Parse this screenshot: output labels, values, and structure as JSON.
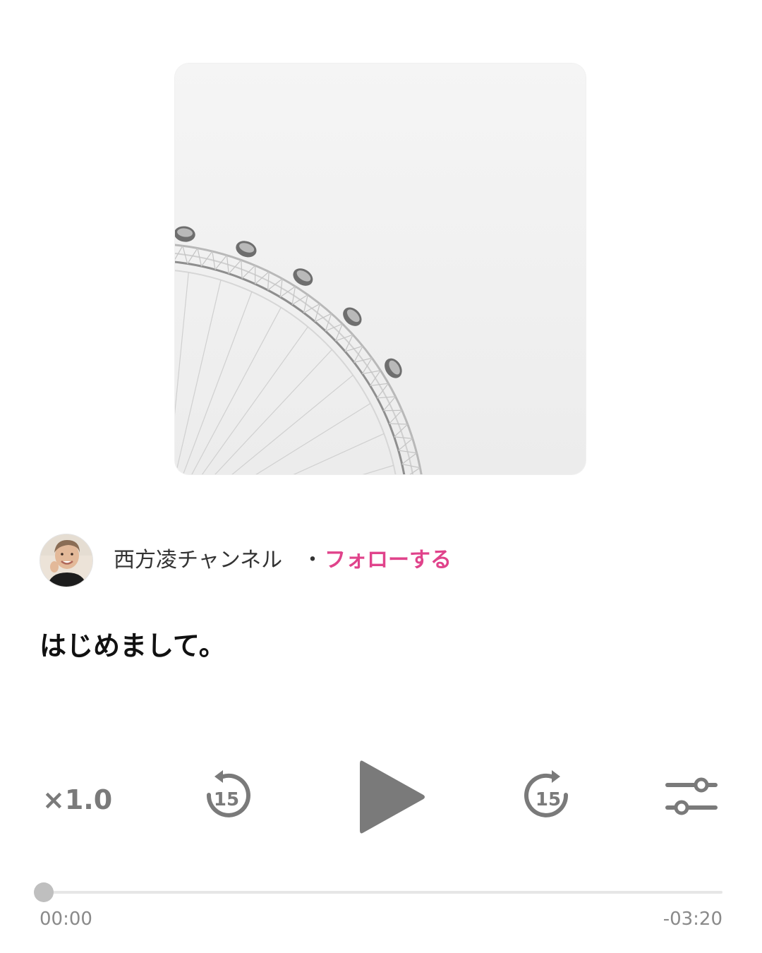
{
  "artwork": {
    "icon": "ferris-wheel-photo"
  },
  "channel": {
    "avatar_icon": "user-avatar-photo",
    "name": "西方凌チャンネル",
    "separator": "・",
    "follow_label": "フォローする"
  },
  "episode": {
    "title": "はじめまして。"
  },
  "controls": {
    "speed_label": "×1.0",
    "skip_back_seconds": "15",
    "skip_forward_seconds": "15",
    "play_icon": "play-icon",
    "settings_icon": "sliders-icon"
  },
  "progress": {
    "fraction": 0,
    "elapsed": "00:00",
    "remaining": "-03:20"
  },
  "colors": {
    "accent": "#e0438b",
    "control_gray": "#7a7a7a",
    "text_primary": "#111111",
    "text_secondary": "#333333",
    "time_gray": "#8a8a8a"
  }
}
